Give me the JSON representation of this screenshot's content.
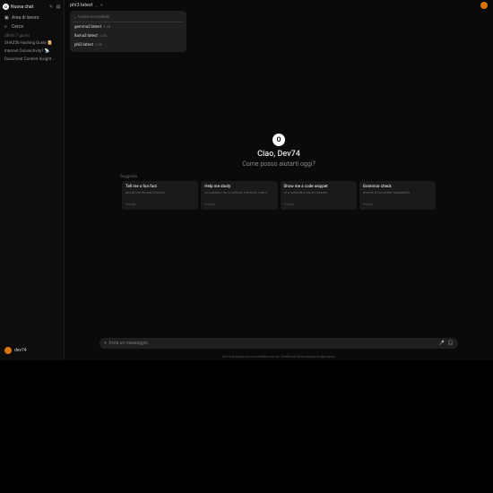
{
  "sidebar": {
    "newChat": "Nuova chat",
    "workspace": "Area di lavoro",
    "search": "Cerca",
    "sectionLabel": "Ultimi 7 giorni",
    "chats": [
      {
        "icon": "📔",
        "label": "SHA256 Hashing Guide 📔"
      },
      {
        "icon": "📡",
        "label": "Internet Connectivity? 📡"
      },
      {
        "icon": "🎯",
        "label": "Document Content Insight 🎯📋"
      }
    ],
    "username": "dev74"
  },
  "topbar": {
    "model": "phi3:latest"
  },
  "dropdown": {
    "searchPlaceholder": "Cerca un modello",
    "items": [
      {
        "name": "gemma2:latest",
        "size": "5.4B"
      },
      {
        "name": "llama3:latest",
        "size": "4.3B"
      },
      {
        "name": "phi3:latest",
        "size": "2.8B"
      }
    ]
  },
  "center": {
    "greeting": "Ciao, Dev74",
    "subtitle": "Come posso aiutarti oggi?",
    "suggestedLabel": "Suggerito"
  },
  "cards": [
    {
      "title": "Tell me a fun fact",
      "sub": "about the Roman Empire",
      "tag": "Prompt"
    },
    {
      "title": "Help me study",
      "sub": "vocabulary for a college entrance exam",
      "tag": "Prompt"
    },
    {
      "title": "Show me a code snippet",
      "sub": "of a website's sticky header",
      "tag": "Prompt"
    },
    {
      "title": "Grammar check",
      "sub": "rewrite it for better readability",
      "tag": "Prompt"
    }
  ],
  "input": {
    "placeholder": "Invia un messaggio"
  },
  "footer": "Gli LLM possono commettere errori. Verificare informazioni importanti."
}
